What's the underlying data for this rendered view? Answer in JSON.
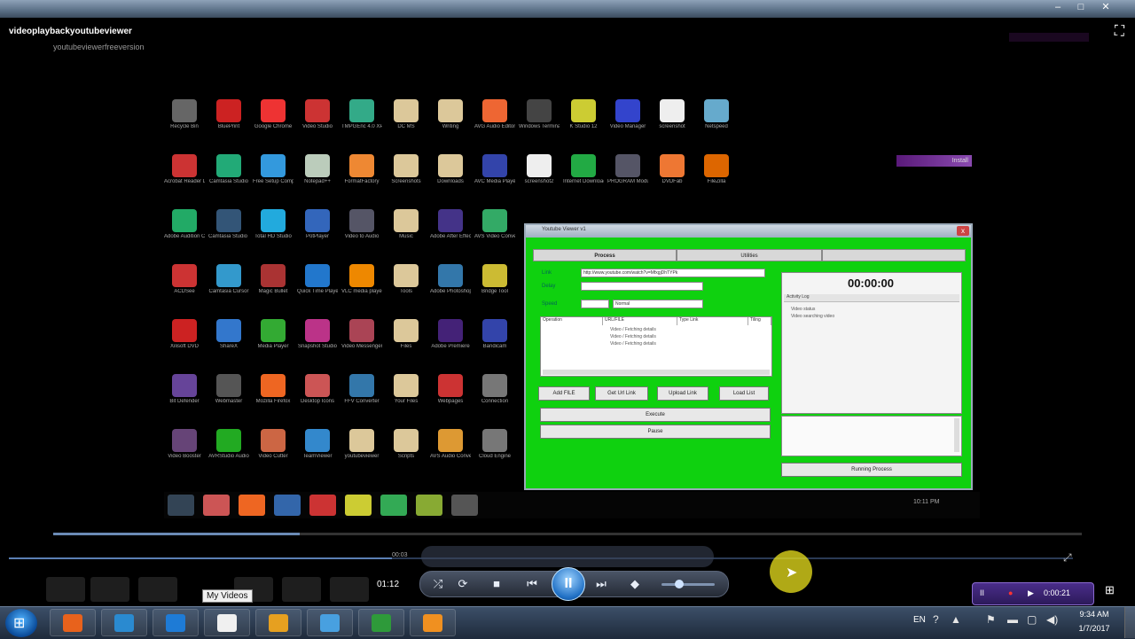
{
  "window": {
    "title": "videoplaybackyoutubeviewer",
    "subtitle": "youtubeviewerfreeversion",
    "controls": [
      "–",
      "□",
      "✕"
    ]
  },
  "desktop_icons": [
    {
      "label": "Recycle Bin",
      "color": "#666"
    },
    {
      "label": "BluePrint",
      "color": "#c22"
    },
    {
      "label": "Google Chrome",
      "color": "#e33"
    },
    {
      "label": "Video Studio",
      "color": "#c33"
    },
    {
      "label": "TMPGEnc 4.0 XPress",
      "color": "#3a8"
    },
    {
      "label": "DC MS",
      "color": "#dcc89a"
    },
    {
      "label": "Writing",
      "color": "#dcc89a"
    },
    {
      "label": "AVG Audio Editor",
      "color": "#e63"
    },
    {
      "label": "Windows Terminal",
      "color": "#444"
    },
    {
      "label": "K Studio 12",
      "color": "#cc3"
    },
    {
      "label": "Video Manager",
      "color": "#34c"
    },
    {
      "label": "screenshot",
      "color": "#eee"
    },
    {
      "label": "Netspeed",
      "color": "#6ac"
    },
    {
      "label": "Acrobat Reader DC",
      "color": "#c33"
    },
    {
      "label": "Camtasia Studio",
      "color": "#2a7"
    },
    {
      "label": "Free Setup Compiler",
      "color": "#39d"
    },
    {
      "label": "Notepad++",
      "color": "#bcb"
    },
    {
      "label": "FormatFactory",
      "color": "#e83"
    },
    {
      "label": "Screenshots",
      "color": "#dcc89a"
    },
    {
      "label": "Downloads",
      "color": "#dcc89a"
    },
    {
      "label": "AVC Media Player",
      "color": "#34a"
    },
    {
      "label": "screenshot2",
      "color": "#eee"
    },
    {
      "label": "Internet Download",
      "color": "#2a4"
    },
    {
      "label": "PROGRAM Modules",
      "color": "#556"
    },
    {
      "label": "DVDFab",
      "color": "#e73"
    },
    {
      "label": "FileZilla",
      "color": "#d60"
    },
    {
      "label": "Adobe Audition CS6",
      "color": "#2a6"
    },
    {
      "label": "Camtasia Studio Menu",
      "color": "#357"
    },
    {
      "label": "Total HD Studio",
      "color": "#2ad"
    },
    {
      "label": "PotPlayer",
      "color": "#36b"
    },
    {
      "label": "Video to Audio",
      "color": "#556"
    },
    {
      "label": "Music",
      "color": "#dcc89a"
    },
    {
      "label": "Adobe After Effects CS6",
      "color": "#438"
    },
    {
      "label": "AVS Video Converter",
      "color": "#3a6"
    },
    {
      "label": "ACDSee",
      "color": "#c33"
    },
    {
      "label": "Camtasia Cursor",
      "color": "#39c"
    },
    {
      "label": "Magic Bullet",
      "color": "#a33"
    },
    {
      "label": "Quick Time Player",
      "color": "#27c"
    },
    {
      "label": "VLC media player",
      "color": "#e80"
    },
    {
      "label": "Tools",
      "color": "#dcc89a"
    },
    {
      "label": "Adobe Photoshop",
      "color": "#37a"
    },
    {
      "label": "Bridge Tool",
      "color": "#cb3"
    },
    {
      "label": "Xilisoft DVD",
      "color": "#c22"
    },
    {
      "label": "ShareX",
      "color": "#37c"
    },
    {
      "label": "Media Player",
      "color": "#3a3"
    },
    {
      "label": "Snapshot Studio",
      "color": "#b38"
    },
    {
      "label": "Video Messenger",
      "color": "#a45"
    },
    {
      "label": "Files",
      "color": "#dcc89a"
    },
    {
      "label": "Adobe Premiere",
      "color": "#427"
    },
    {
      "label": "Bandicam",
      "color": "#34a"
    },
    {
      "label": "Bit Defender",
      "color": "#649"
    },
    {
      "label": "Webmaster",
      "color": "#555"
    },
    {
      "label": "Mozilla Firefox",
      "color": "#e62"
    },
    {
      "label": "Desktop Icons",
      "color": "#c55"
    },
    {
      "label": "FFV Converter",
      "color": "#37a"
    },
    {
      "label": "Your Files",
      "color": "#dcc89a"
    },
    {
      "label": "Webpages",
      "color": "#c33"
    },
    {
      "label": "Connection",
      "color": "#777"
    },
    {
      "label": "Video Booster",
      "color": "#647"
    },
    {
      "label": "AVRStudio Audio",
      "color": "#2a2"
    },
    {
      "label": "Video Cutter",
      "color": "#c64"
    },
    {
      "label": "TeamViewer",
      "color": "#38c"
    },
    {
      "label": "youtubeviewer",
      "color": "#dcc89a"
    },
    {
      "label": "Scripts",
      "color": "#dcc89a"
    },
    {
      "label": "AVS Audio Converter",
      "color": "#d93"
    },
    {
      "label": "Cloud Engine",
      "color": "#777"
    }
  ],
  "inner_taskbar": [
    "#345",
    "#c55",
    "#e62",
    "#36a",
    "#c33",
    "#cc3",
    "#3a5",
    "#8a3",
    "#555"
  ],
  "inner_tray": "10:11 PM",
  "purple_bar_label": "Install",
  "app": {
    "title": "Youtube Viewer v1",
    "close": "x",
    "tabs": [
      "Process",
      "Utilities",
      ""
    ],
    "url_label": "Link",
    "url_value": "http://www.youtube.com/watch?v=MfxgjDhTYPk",
    "field2_label": "Delay",
    "field3_label": "Speed",
    "combo_value": "Normal",
    "list_headers": [
      "Operation",
      "URL/FILE",
      "Type Link",
      "Tiling"
    ],
    "list_rows": [
      "Video / Fetching details",
      "Video / Fetching details",
      "Video / Fetching details"
    ],
    "buttons": [
      "Add FILE",
      "Get Url Link",
      "Upload Link",
      "Load List"
    ],
    "action_buttons": [
      "Execute",
      "Pause"
    ],
    "clock": "00:00:00",
    "log_header": "Activity Log",
    "log_lines": [
      "Video status",
      "Video searching video"
    ],
    "bottom_button": "Running Process"
  },
  "player": {
    "elapsed_ghost": "00:03",
    "elapsed": "01:12",
    "controls": {
      "shuffle": "⤮",
      "repeat": "⟳",
      "stop": "■",
      "prev": "⏮",
      "play_pause": "II",
      "next": "⏭",
      "mute": "◆"
    },
    "tooltip": "My Videos",
    "progress_fraction": 0.24,
    "seek_fraction": 0.36,
    "volume_fraction": 0.25
  },
  "recorder": {
    "time": "0:00:21",
    "record": "●",
    "play": "▶"
  },
  "taskbar": {
    "start": "⊞",
    "apps": [
      {
        "name": "firefox",
        "color": "#e8621c"
      },
      {
        "name": "outlook",
        "color": "#2a8ad0"
      },
      {
        "name": "ring",
        "color": "#1e7bd6"
      },
      {
        "name": "notepad",
        "color": "#f0f0f0"
      },
      {
        "name": "editor",
        "color": "#e6a020"
      },
      {
        "name": "network",
        "color": "#48a0e0"
      },
      {
        "name": "terminal",
        "color": "#2e9a3a"
      },
      {
        "name": "media",
        "color": "#f09020"
      }
    ],
    "lang": "EN",
    "tray_icons": [
      "?",
      "▲",
      "⚑",
      "▬",
      "▢",
      "◀)"
    ],
    "time": "9:34 AM",
    "date": "1/7/2017"
  }
}
